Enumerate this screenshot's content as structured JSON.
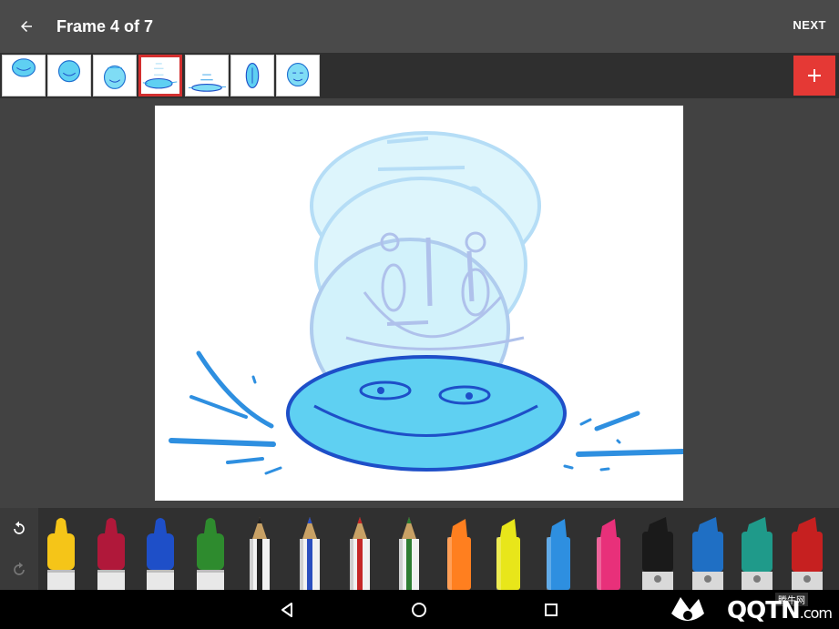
{
  "header": {
    "back_icon": "arrow-left-icon",
    "title": "Frame 4 of 7",
    "next_label": "NEXT"
  },
  "frames": {
    "count": 7,
    "selected_index": 3,
    "add_icon": "plus-icon",
    "accent_color": "#e53935"
  },
  "tools": {
    "undo_icon": "undo-icon",
    "redo_icon": "redo-icon",
    "pens": [
      {
        "name": "marker-yellow",
        "type": "marker",
        "color": "#f5c518"
      },
      {
        "name": "marker-crimson",
        "type": "marker",
        "color": "#b0183a"
      },
      {
        "name": "marker-blue",
        "type": "marker",
        "color": "#1e4fc8"
      },
      {
        "name": "marker-green",
        "type": "marker",
        "color": "#2e8b2e"
      },
      {
        "name": "pencil-black",
        "type": "pencil",
        "color": "#222222"
      },
      {
        "name": "pencil-blue",
        "type": "pencil",
        "color": "#2b4fbf"
      },
      {
        "name": "pencil-red",
        "type": "pencil",
        "color": "#c62828"
      },
      {
        "name": "pencil-green",
        "type": "pencil",
        "color": "#2e7d32"
      },
      {
        "name": "highlighter-orange",
        "type": "highlighter",
        "color": "#ff7f1f"
      },
      {
        "name": "highlighter-yellow",
        "type": "highlighter",
        "color": "#e8e61a"
      },
      {
        "name": "highlighter-blue",
        "type": "highlighter",
        "color": "#2e8fe0"
      },
      {
        "name": "highlighter-pink",
        "type": "highlighter",
        "color": "#e8307a"
      },
      {
        "name": "chisel-black",
        "type": "chisel",
        "color": "#1a1a1a"
      },
      {
        "name": "chisel-blue",
        "type": "chisel",
        "color": "#1f6fc4"
      },
      {
        "name": "chisel-teal",
        "type": "chisel",
        "color": "#1f9a8a"
      },
      {
        "name": "chisel-red",
        "type": "chisel",
        "color": "#c62020"
      }
    ]
  },
  "navbar": {
    "back_icon": "nav-back-icon",
    "home_icon": "nav-home-icon",
    "recents_icon": "nav-recents-icon"
  },
  "watermark": {
    "text": "QQTN",
    "suffix": ".com",
    "chinese": "腾牛网"
  },
  "colors": {
    "drawing_blue": "#2e9fe8",
    "drawing_dark": "#1e4fc8",
    "drawing_light": "#5fd0f2"
  }
}
